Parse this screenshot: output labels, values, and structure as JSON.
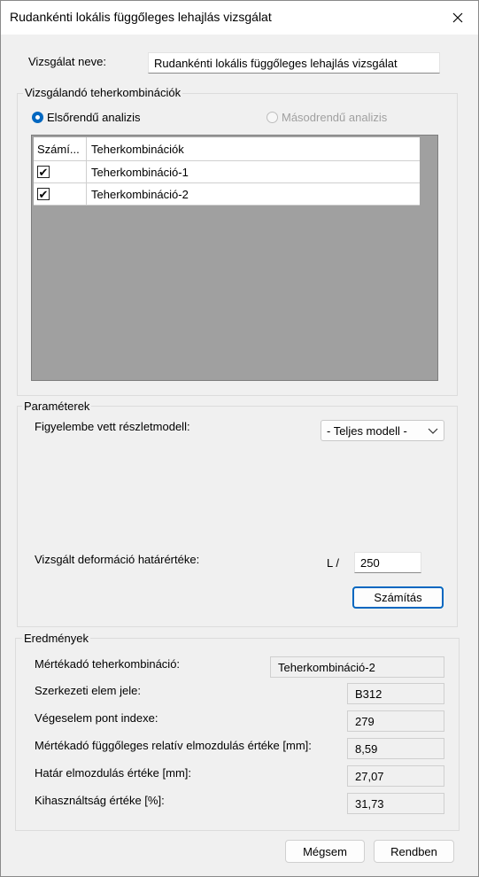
{
  "window": {
    "title": "Rudankénti lokális függőleges lehajlás vizsgálat"
  },
  "test_name": {
    "label": "Vizsgálat neve:",
    "value": "Rudankénti lokális függőleges lehajlás vizsgálat"
  },
  "load_combinations": {
    "group_label": "Vizsgálandó teherkombinációk",
    "radio_first": "Elsőrendű analizis",
    "radio_second": "Másodrendű analizis",
    "columns": [
      "Számí...",
      "Teherkombinációk"
    ],
    "rows": [
      {
        "checked": true,
        "name": "Teherkombináció-1"
      },
      {
        "checked": true,
        "name": "Teherkombináció-2"
      }
    ]
  },
  "parameters": {
    "group_label": "Paraméterek",
    "model_label": "Figyelembe vett részletmodell:",
    "model_value": "- Teljes modell -",
    "deformation_label": "Vizsgált deformáció határértéke:",
    "l_prefix": "L /",
    "l_value": "250",
    "calculate_button": "Számítás"
  },
  "results": {
    "group_label": "Eredmények",
    "items": [
      {
        "label": "Mértékadó teherkombináció:",
        "value": "Teherkombináció-2"
      },
      {
        "label": "Szerkezeti elem jele:",
        "value": "B312"
      },
      {
        "label": "Végeselem pont indexe:",
        "value": "279"
      },
      {
        "label": "Mértékadó függőleges relatív elmozdulás értéke [mm]:",
        "value": "8,59"
      },
      {
        "label": "Határ elmozdulás értéke [mm]:",
        "value": "27,07"
      },
      {
        "label": "Kihasználtság értéke [%]:",
        "value": "31,73"
      }
    ]
  },
  "footer": {
    "cancel": "Mégsem",
    "ok": "Rendben"
  },
  "colors": {
    "accent": "#0067c0",
    "grid_bg": "#a0a0a0",
    "window_bg": "#f0f0f0"
  }
}
